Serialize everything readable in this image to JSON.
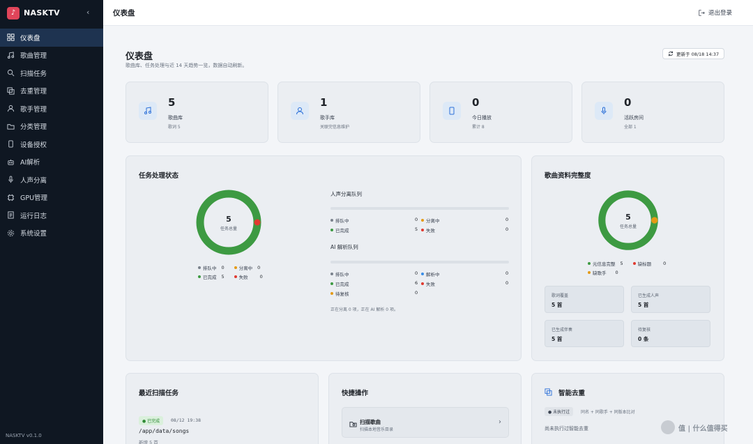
{
  "app": {
    "name": "NASKTV",
    "version": "NASKTV v0.1.0"
  },
  "colors": {
    "green": "#3d9a42",
    "red": "#e03a30",
    "orange": "#e49a14",
    "blue": "#3a8ee6",
    "gray": "#7a828c",
    "sidebar": "#0f1722",
    "accent": "#2a6fd8"
  },
  "sidebar": {
    "items": [
      {
        "label": "仪表盘",
        "icon": "dashboard-icon"
      },
      {
        "label": "歌曲管理",
        "icon": "music-icon"
      },
      {
        "label": "扫描任务",
        "icon": "search-icon"
      },
      {
        "label": "去重管理",
        "icon": "dedupe-icon"
      },
      {
        "label": "歌手管理",
        "icon": "user-icon"
      },
      {
        "label": "分类管理",
        "icon": "folder-icon"
      },
      {
        "label": "设备授权",
        "icon": "device-icon"
      },
      {
        "label": "AI解析",
        "icon": "robot-icon"
      },
      {
        "label": "人声分离",
        "icon": "mic-icon"
      },
      {
        "label": "GPU管理",
        "icon": "chip-icon"
      },
      {
        "label": "运行日志",
        "icon": "log-icon"
      },
      {
        "label": "系统设置",
        "icon": "gear-icon"
      }
    ]
  },
  "topbar": {
    "title": "仪表盘",
    "logout": "退出登录"
  },
  "page": {
    "title": "仪表盘",
    "subtitle": "歌曲库、任务处理与近 14 天趋势一览，数据自动刷新。",
    "update": "更新于 08/18 14:37"
  },
  "stats": [
    {
      "value": "5",
      "label": "歌曲库",
      "sub": "歌词 5"
    },
    {
      "value": "1",
      "label": "歌手库",
      "sub": "关联完信息维护"
    },
    {
      "value": "0",
      "label": "今日播放",
      "sub": "累计 8"
    },
    {
      "value": "0",
      "label": "活跃房间",
      "sub": "全部 1"
    }
  ],
  "task_status": {
    "title": "任务处理状态",
    "total": "5",
    "total_label": "任务总量",
    "completed": 5,
    "failed": 0,
    "legend": [
      {
        "label": "排队中",
        "value": "0",
        "color": "gray"
      },
      {
        "label": "分离中",
        "value": "0",
        "color": "orange"
      },
      {
        "label": "已完成",
        "value": "5",
        "color": "green"
      },
      {
        "label": "失败",
        "value": "0",
        "color": "red"
      }
    ],
    "vocal_queue": {
      "title": "人声分离队列",
      "rows": [
        {
          "label": "排队中",
          "value": "0",
          "color": "gray"
        },
        {
          "label": "分离中",
          "value": "0",
          "color": "orange"
        },
        {
          "label": "已完成",
          "value": "5",
          "color": "green"
        },
        {
          "label": "失败",
          "value": "0",
          "color": "red"
        }
      ]
    },
    "ai_queue": {
      "title": "AI 解析队列",
      "rows": [
        {
          "label": "排队中",
          "value": "0",
          "color": "gray"
        },
        {
          "label": "解析中",
          "value": "0",
          "color": "blue"
        },
        {
          "label": "已完成",
          "value": "6",
          "color": "green"
        },
        {
          "label": "失败",
          "value": "0",
          "color": "red"
        },
        {
          "label": "待复核",
          "value": "0",
          "color": "orange"
        }
      ]
    },
    "note": "正在分离 0 项，正在 AI 解析 0 项。"
  },
  "completeness": {
    "title": "歌曲资料完整度",
    "total": "5",
    "total_label": "任务总量",
    "legend": [
      {
        "label": "元信息完整",
        "value": "5",
        "color": "green"
      },
      {
        "label": "缺标题",
        "value": "0",
        "color": "red"
      },
      {
        "label": "缺歌手",
        "value": "0",
        "color": "orange"
      }
    ],
    "tiles": [
      {
        "label": "歌词覆盖",
        "value": "5 首"
      },
      {
        "label": "已生成人声",
        "value": "5 首"
      },
      {
        "label": "已生成伴奏",
        "value": "5 首"
      },
      {
        "label": "待复核",
        "value": "0 条"
      }
    ]
  },
  "recent_scan": {
    "title": "最近扫描任务",
    "status": "● 已完成",
    "time": "08/12 19:38",
    "path": "/app/data/songs",
    "detail": "新增 5 首"
  },
  "quick_actions": {
    "title": "快捷操作",
    "item_title": "扫描歌曲",
    "item_sub": "扫描本地音乐目录"
  },
  "smart_dedupe": {
    "title": "智能去重",
    "badge": "● 未执行过",
    "tags": "同名 + 同歌手 + 同版本比对",
    "note": "尚未执行过智能去重"
  },
  "watermark": "值 | 什么值得买"
}
